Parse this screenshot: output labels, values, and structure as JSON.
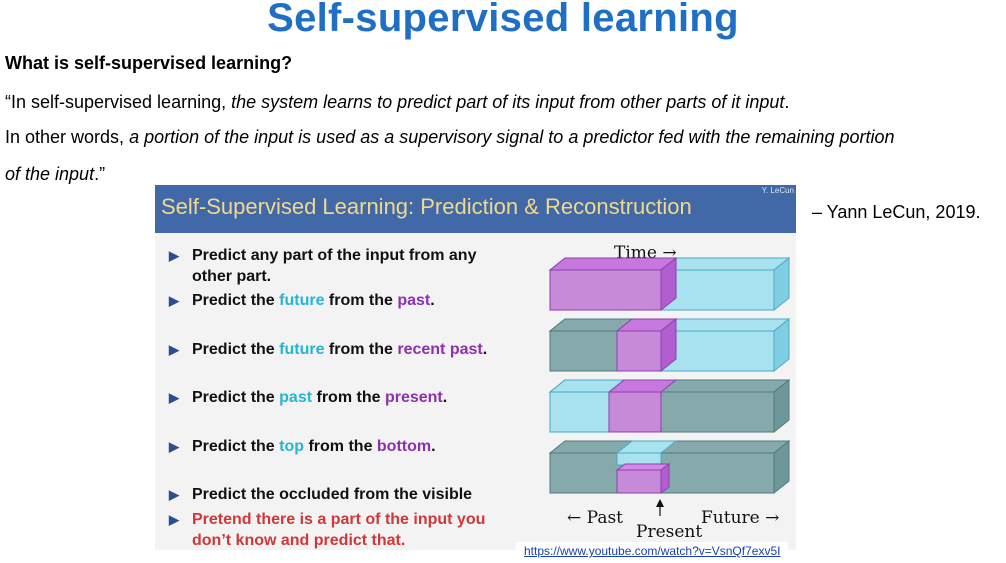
{
  "page": {
    "title": "Self-supervised learning",
    "question": "What is self-supervised learning?",
    "quote": {
      "l1_open": "“In self-supervised learning, ",
      "l1_em": "the system learns to predict part of its input from other parts of it input",
      "l1_end": ".",
      "l2_start": "In other words, ",
      "l2_em": "a portion of the input is used as a supervisory signal to a predictor fed with the remaining portion",
      "l3_em": "of the input",
      "l3_end": ".”"
    },
    "attribution": "– Yann LeCun, 2019.",
    "link": "https://www.youtube.com/watch?v=VsnQf7exv5I"
  },
  "slide": {
    "title": "Self-Supervised Learning: Prediction & Reconstruction",
    "credit": "Y. LeCun",
    "bullets": {
      "b1": "Predict any part of the input from any",
      "b1b": "other part.",
      "b2_a": "Predict the ",
      "b2_b": "future",
      "b2_c": " from the ",
      "b2_d": "past",
      "b2_e": ".",
      "b3_a": "Predict the ",
      "b3_b": "future",
      "b3_c": " from the ",
      "b3_d": "recent past",
      "b3_e": ".",
      "b4_a": "Predict the ",
      "b4_b": "past",
      "b4_c": " from the ",
      "b4_d": "present",
      "b4_e": ".",
      "b5_a": "Predict the ",
      "b5_b": "top",
      "b5_c": " from the ",
      "b5_d": "bottom",
      "b5_e": ".",
      "b6": "Predict the occluded from the visible",
      "b7": "Pretend there is a part of the input you",
      "b7b": "don’t know and predict that."
    },
    "diagram": {
      "time": "Time →",
      "past": "← Past",
      "future": "Future →",
      "present": "Present"
    },
    "colors": {
      "header": "#4169a8",
      "title_text": "#f2d88b",
      "cyan": "#24b5d8",
      "purple": "#8e2fb0",
      "red": "#cf3838"
    }
  }
}
